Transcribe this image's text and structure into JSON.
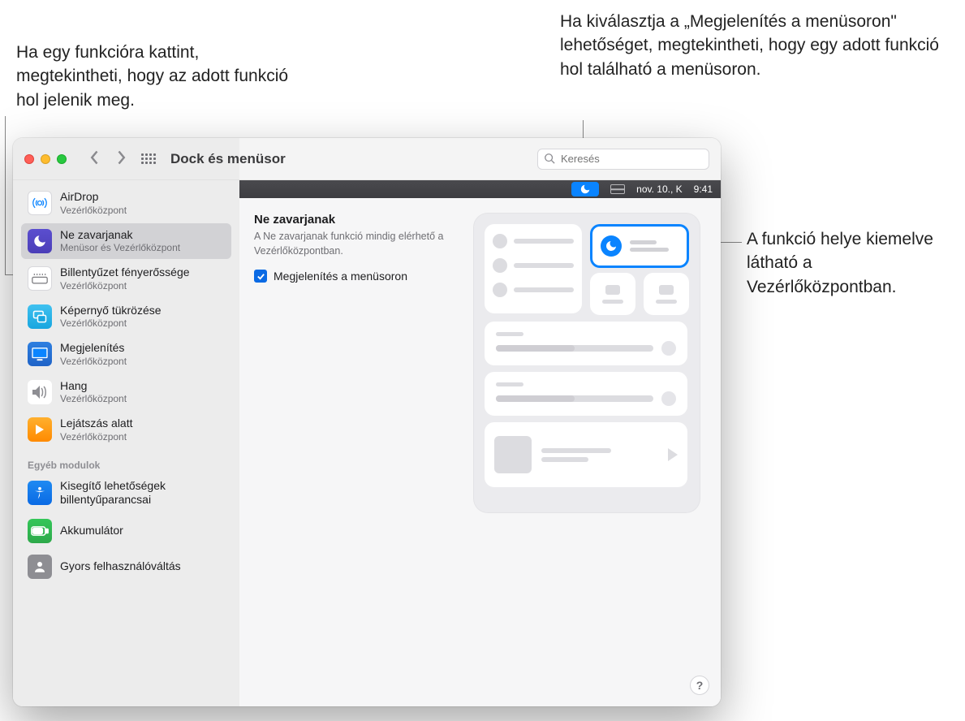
{
  "callouts": {
    "c1": "Ha egy funkcióra kattint, megtekintheti, hogy az adott funkció hol jelenik meg.",
    "c2": "Ha kiválasztja a „Megjelenítés a menüsoron\" lehetőséget, megtekintheti, hogy egy adott funkció hol található a menüsoron.",
    "c3": "A funkció helye kiemelve látható a Vezérlőközpontban."
  },
  "window": {
    "title": "Dock és menüsor",
    "search_placeholder": "Keresés"
  },
  "menubar": {
    "date": "nov. 10., K",
    "time": "9:41"
  },
  "sidebar": {
    "items": [
      {
        "label": "AirDrop",
        "sub": "Vezérlőközpont"
      },
      {
        "label": "Ne zavarjanak",
        "sub": "Menüsor és Vezérlőközpont"
      },
      {
        "label": "Billentyűzet fényerőssége",
        "sub": "Vezérlőközpont"
      },
      {
        "label": "Képernyő tükrözése",
        "sub": "Vezérlőközpont"
      },
      {
        "label": "Megjelenítés",
        "sub": "Vezérlőközpont"
      },
      {
        "label": "Hang",
        "sub": "Vezérlőközpont"
      },
      {
        "label": "Lejátszás alatt",
        "sub": "Vezérlőközpont"
      }
    ],
    "other_section": "Egyéb modulok",
    "other_items": [
      {
        "label": "Kisegítő lehetőségek billentyűparancsai"
      },
      {
        "label": "Akkumulátor"
      },
      {
        "label": "Gyors felhasználóváltás"
      }
    ]
  },
  "panel": {
    "title": "Ne zavarjanak",
    "desc": "A Ne zavarjanak funkció mindig elérhető a Vezérlőközpontban.",
    "checkbox_label": "Megjelenítés a menüsoron"
  },
  "help": "?"
}
